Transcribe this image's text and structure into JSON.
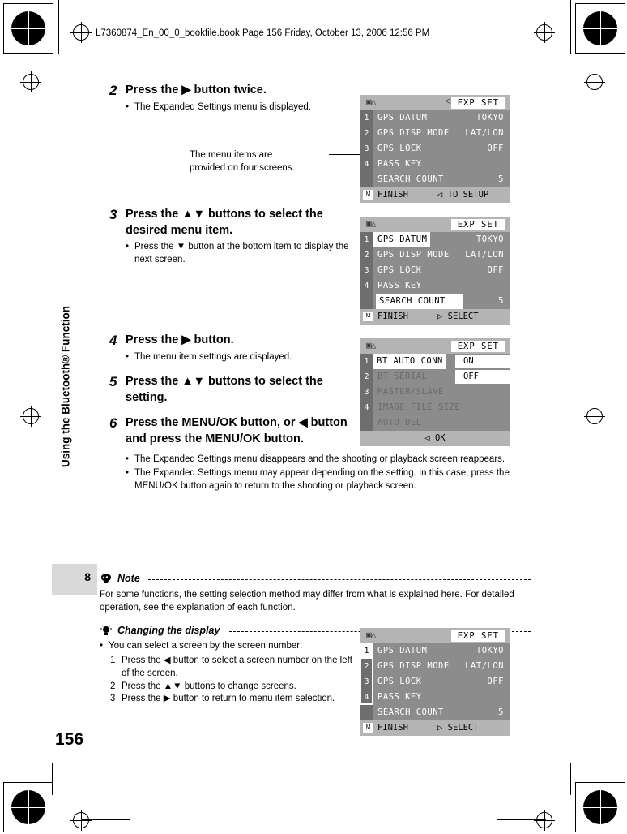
{
  "header": {
    "filebar": "L7360874_En_00_0_bookfile.book  Page 156  Friday, October 13, 2006  12:56 PM"
  },
  "sidetab": {
    "label": "Using the Bluetooth® Function",
    "chapter_number": "8",
    "page_number": "156"
  },
  "steps": [
    {
      "num": "2",
      "heading": "Press the ▶ button twice.",
      "bullets": [
        "The Expanded Settings menu is displayed."
      ]
    },
    {
      "num": "3",
      "heading": "Press the ▲▼ buttons to select the desired menu item.",
      "bullets": [
        "Press the ▼ button at the bottom item to display the next screen."
      ]
    },
    {
      "num": "4",
      "heading": "Press the ▶ button.",
      "bullets": [
        "The menu item settings are displayed."
      ]
    },
    {
      "num": "5",
      "heading": "Press the ▲▼ buttons to select the setting.",
      "bullets": []
    },
    {
      "num": "6",
      "heading": "Press the MENU/OK button, or ◀ button and press the MENU/OK button.",
      "bullets": [
        "The Expanded Settings menu disappears and the shooting or playback screen reappears.",
        "The Expanded Settings menu may appear depending on the setting. In this case, press the MENU/OK button again to return to the shooting or playback screen."
      ]
    }
  ],
  "callout": {
    "line1": "The menu items are",
    "line2": "provided on four screens."
  },
  "note": {
    "title": "Note",
    "body": "For some functions, the setting selection method may differ from what is explained here. For detailed operation, see the explanation of each function."
  },
  "tip": {
    "title": "Changing the display",
    "bullet": "You can select a screen by the screen number:",
    "items": [
      {
        "n": "1",
        "text": "Press the ◀ button to select a screen number on the left of the screen."
      },
      {
        "n": "2",
        "text": "Press the ▲▼ buttons to change screens."
      },
      {
        "n": "3",
        "text": "Press the ▶ button to return to menu item selection."
      }
    ]
  },
  "screens": [
    {
      "id": "screen-1",
      "title": "EXP SET",
      "icon": "camera-mode-icon",
      "left_arrow": "◁",
      "rows": [
        {
          "idx": "1",
          "label": "GPS DATUM",
          "value": "TOKYO"
        },
        {
          "idx": "2",
          "label": "GPS DISP MODE",
          "value": "LAT/LON"
        },
        {
          "idx": "3",
          "label": "GPS LOCK",
          "value": "OFF"
        },
        {
          "idx": "4",
          "label": "PASS KEY",
          "value": ""
        },
        {
          "idx": "",
          "label": "SEARCH COUNT",
          "value": "5"
        }
      ],
      "bottom_left": "FINISH",
      "bottom_right": "◁ TO SETUP"
    },
    {
      "id": "screen-2",
      "title": "EXP SET",
      "icon": "camera-mode-icon",
      "rows": [
        {
          "idx": "1",
          "label": "GPS DATUM",
          "value": "TOKYO"
        },
        {
          "idx": "2",
          "label": "GPS DISP MODE",
          "value": "LAT/LON"
        },
        {
          "idx": "3",
          "label": "GPS LOCK",
          "value": "OFF"
        },
        {
          "idx": "4",
          "label": "PASS KEY",
          "value": ""
        },
        {
          "idx": "",
          "label": "SEARCH COUNT",
          "value": "5",
          "selected": true
        }
      ],
      "bottom_left": "FINISH",
      "bottom_right": "▷ SELECT"
    },
    {
      "id": "screen-3",
      "title": "EXP SET",
      "icon": "camera-mode-icon",
      "rows": [
        {
          "idx": "1",
          "label": "BT AUTO CONN",
          "value": "",
          "selected": true
        },
        {
          "idx": "2",
          "label": "BT SERIAL",
          "value": "",
          "dim": true
        },
        {
          "idx": "3",
          "label": "MASTER/SLAVE",
          "value": "",
          "dim": true
        },
        {
          "idx": "4",
          "label": "IMAGE FILE SIZE",
          "value": "",
          "dim": true
        },
        {
          "idx": "",
          "label": "AUTO DEL",
          "value": "",
          "dim": true
        }
      ],
      "option_on": "ON",
      "option_off": "OFF",
      "option_arrow": "◁",
      "bottom_center": "◁ OK"
    },
    {
      "id": "screen-4",
      "title": "EXP SET",
      "icon": "camera-mode-icon",
      "rows": [
        {
          "idx": "1",
          "label": "GPS DATUM",
          "value": "TOKYO"
        },
        {
          "idx": "2",
          "label": "GPS DISP MODE",
          "value": "LAT/LON"
        },
        {
          "idx": "3",
          "label": "GPS LOCK",
          "value": "OFF"
        },
        {
          "idx": "4",
          "label": "PASS KEY",
          "value": ""
        },
        {
          "idx": "",
          "label": "SEARCH COUNT",
          "value": "5"
        }
      ],
      "bottom_left": "FINISH",
      "bottom_right": "▷ SELECT"
    }
  ]
}
